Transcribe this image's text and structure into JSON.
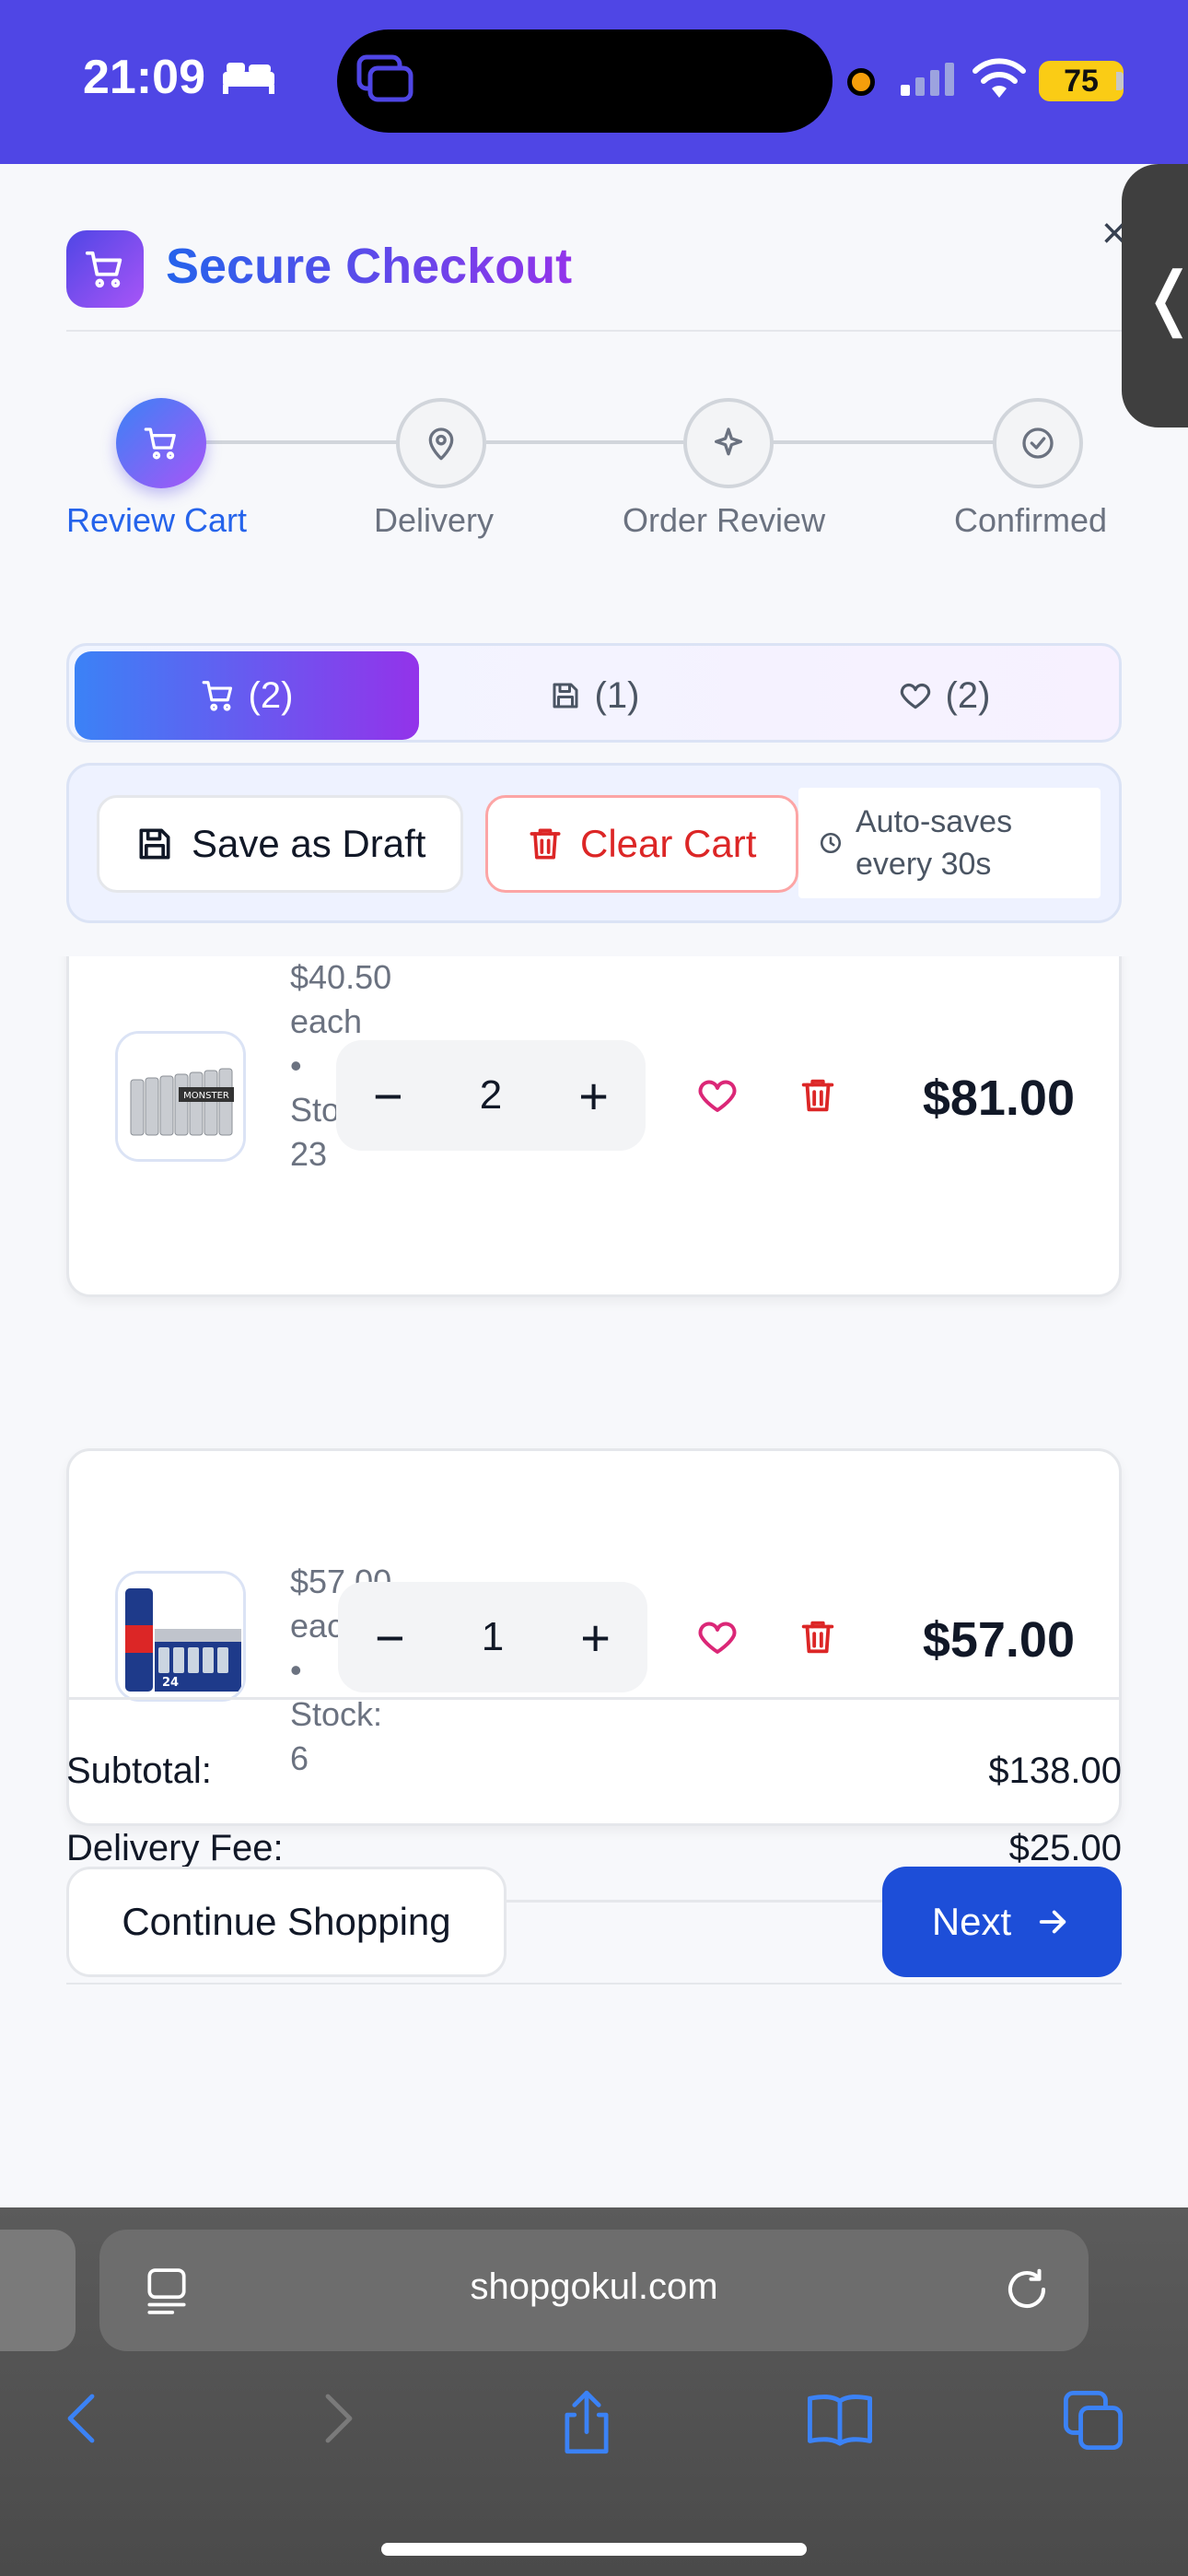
{
  "status_bar": {
    "time": "21:09",
    "battery": "75"
  },
  "header": {
    "title": "Secure Checkout",
    "close": "×"
  },
  "steps": [
    {
      "label": "Review Cart"
    },
    {
      "label": "Delivery"
    },
    {
      "label": "Order Review"
    },
    {
      "label": "Confirmed"
    }
  ],
  "tabs": [
    {
      "label": "(2)",
      "icon": "cart-icon"
    },
    {
      "label": "(1)",
      "icon": "save-icon"
    },
    {
      "label": "(2)",
      "icon": "heart-icon"
    }
  ],
  "actions": {
    "save_draft": "Save as Draft",
    "clear_cart": "Clear Cart",
    "autosave_line1": "Auto-saves",
    "autosave_line2": "every 30s"
  },
  "items": [
    {
      "price_each": "$40.50",
      "each_label": "each",
      "dot": "•",
      "stock_label": "Stock:",
      "stock": "23",
      "qty": "2",
      "total": "$81.00"
    },
    {
      "price_each": "$57.00",
      "each_label": "each",
      "dot": "•",
      "stock_label": "Stock:",
      "stock": "6",
      "qty": "1",
      "total": "$57.00"
    }
  ],
  "summary": {
    "subtotal_label": "Subtotal:",
    "subtotal_value": "$138.00",
    "delivery_label": "Delivery Fee:",
    "delivery_value": "$25.00"
  },
  "footer": {
    "continue_label": "Continue Shopping",
    "next_label": "Next"
  },
  "browser": {
    "url": "shopgokul.com"
  },
  "colors": {
    "accent": "#4f46e5",
    "primary": "#1d4ed8",
    "danger": "#dc2626",
    "heart": "#db2777"
  }
}
